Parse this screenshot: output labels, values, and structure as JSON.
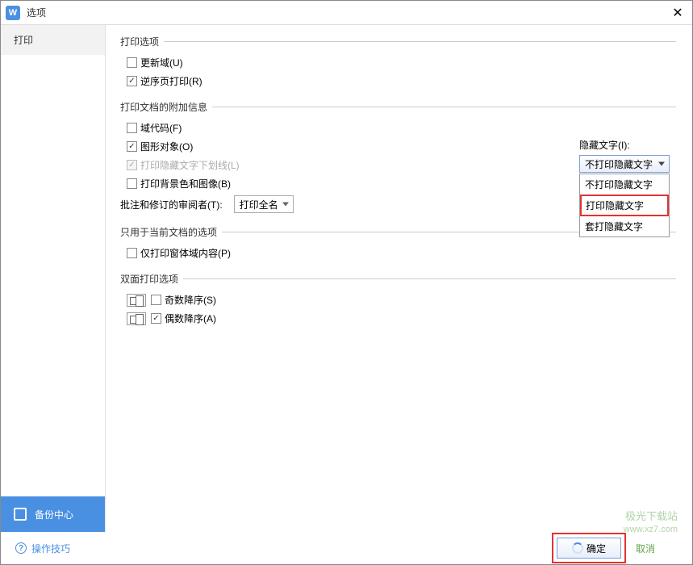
{
  "title": "选项",
  "sidebar": {
    "items": [
      {
        "label": "打印"
      }
    ],
    "backup_label": "备份中心"
  },
  "sections": {
    "print_options": {
      "legend": "打印选项",
      "update_fields": "更新域(U)",
      "reverse_order": "逆序页打印(R)"
    },
    "additional_info": {
      "legend": "打印文档的附加信息",
      "field_codes": "域代码(F)",
      "graphics": "图形对象(O)",
      "hidden_underline": "打印隐藏文字下划线(L)",
      "background": "打印背景色和图像(B)",
      "review_label": "批注和修订的审阅者(T):",
      "review_value": "打印全名"
    },
    "hidden_text": {
      "label": "隐藏文字(I):",
      "selected": "不打印隐藏文字",
      "options": [
        "不打印隐藏文字",
        "打印隐藏文字",
        "套打隐藏文字"
      ]
    },
    "current_doc": {
      "legend": "只用于当前文档的选项",
      "print_form_only": "仅打印窗体域内容(P)"
    },
    "duplex": {
      "legend": "双面打印选项",
      "odd": "奇数降序(S)",
      "even": "偶数降序(A)"
    }
  },
  "footer": {
    "tips": "操作技巧",
    "ok": "确定",
    "cancel": "取消"
  },
  "watermark": {
    "line1": "极光下载站",
    "line2": "www.xz7.com"
  }
}
